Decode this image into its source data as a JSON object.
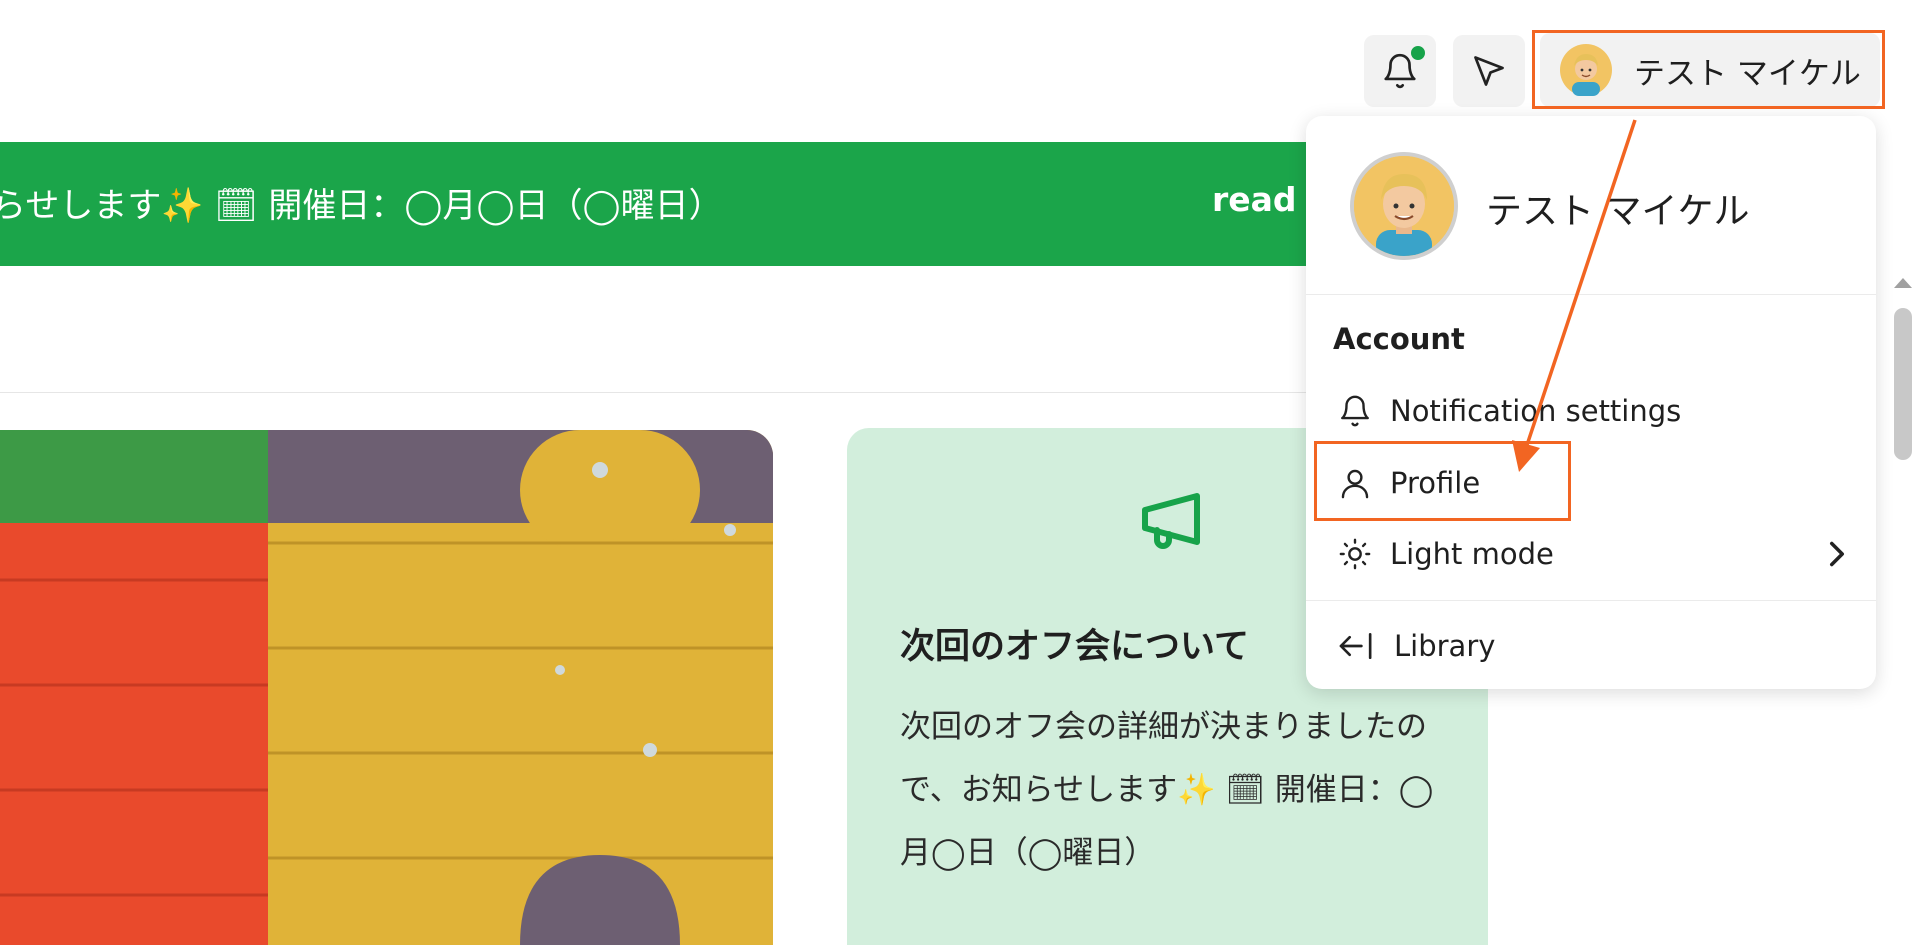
{
  "header": {
    "user_button": {
      "name": "テスト マイケル"
    },
    "icons": {
      "bell": "bell-icon",
      "send": "send-icon"
    }
  },
  "banner": {
    "text": "らせします✨ 🗓 開催日：◯月◯日（◯曜日）",
    "read_more": "read m"
  },
  "card": {
    "title": "次回のオフ会について",
    "body": "次回のオフ会の詳細が決まりましたので、お知らせします✨ 🗓 開催日：◯月◯日（◯曜日）"
  },
  "dropdown": {
    "user_name": "テスト マイケル",
    "section_label": "Account",
    "items": [
      {
        "label": "Notification settings",
        "icon": "bell-icon"
      },
      {
        "label": "Profile",
        "icon": "user-icon"
      },
      {
        "label": "Light mode",
        "icon": "sun-icon"
      },
      {
        "label": "Library",
        "icon": "arrow-left-bar-icon"
      }
    ]
  },
  "colors": {
    "banner_green": "#1ba54a",
    "card_green": "#d2eedc",
    "annotation_orange": "#f26522",
    "notif_dot": "#17a34a"
  }
}
